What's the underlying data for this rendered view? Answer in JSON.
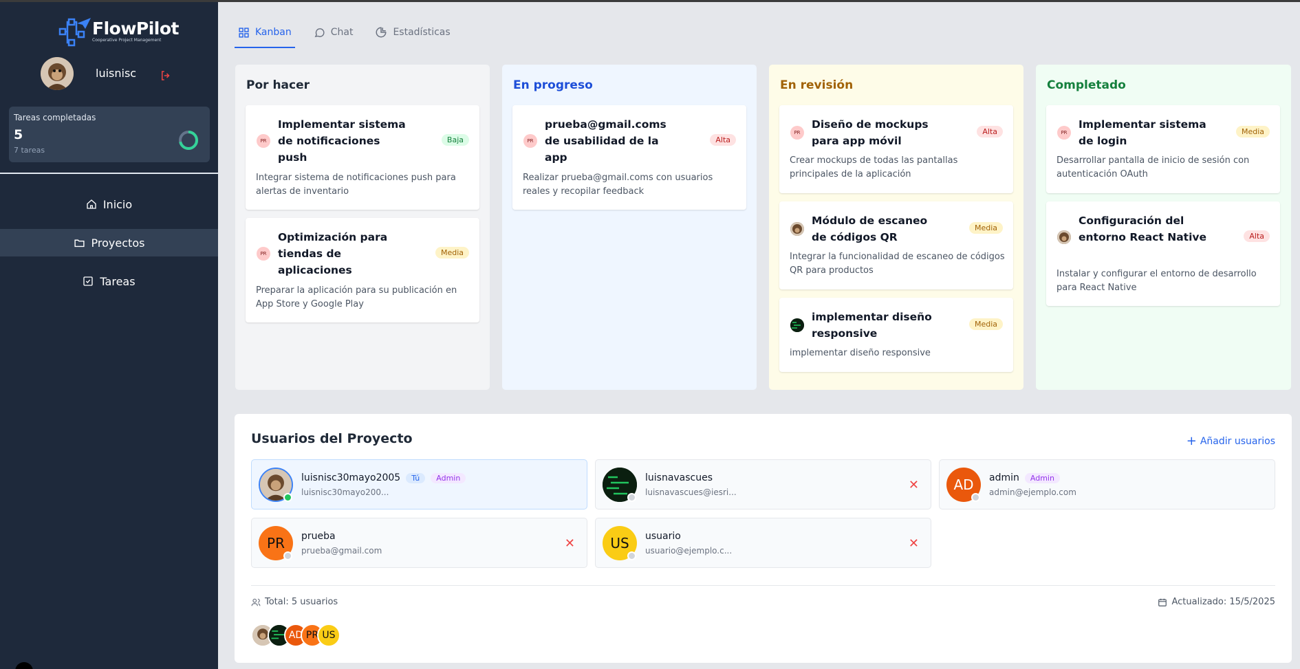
{
  "app": {
    "name": "FlowPilot",
    "tagline": "Cooperative Project Management"
  },
  "sidebar": {
    "user_name": "luisnisc",
    "stats": {
      "label": "Tareas completadas",
      "count": "5",
      "total": "7 tareas",
      "progress": 0.714
    },
    "nav": [
      {
        "label": "Inicio",
        "icon": "home-icon"
      },
      {
        "label": "Proyectos",
        "icon": "folder-icon",
        "active": true
      },
      {
        "label": "Tareas",
        "icon": "check-square-icon"
      }
    ]
  },
  "tabs": [
    {
      "label": "Kanban",
      "icon": "grid-icon",
      "active": true
    },
    {
      "label": "Chat",
      "icon": "chat-bubble-icon"
    },
    {
      "label": "Estadísticas",
      "icon": "pie-chart-icon"
    }
  ],
  "columns": [
    {
      "title": "Por hacer",
      "color": "#1f2937",
      "bg": "#f3f4f6",
      "cards": [
        {
          "avatar": "PR",
          "title": "Implementar sistema de notificaciones push",
          "priority": "Baja",
          "desc": "Integrar sistema de notificaciones push para alertas de inventario"
        },
        {
          "avatar": "PR",
          "title": "Optimización para tiendas de aplicaciones",
          "priority": "Media",
          "desc": "Preparar la aplicación para su publicación en App Store y Google Play"
        }
      ]
    },
    {
      "title": "En progreso",
      "color": "#1d4ed8",
      "bg": "#eff6ff",
      "cards": [
        {
          "avatar": "PR",
          "title": "prueba@gmail.coms de usabilidad de la app",
          "priority": "Alta",
          "desc": "Realizar prueba@gmail.coms con usuarios reales y recopilar feedback"
        }
      ]
    },
    {
      "title": "En revisión",
      "color": "#a16207",
      "bg": "#fefce8",
      "cards": [
        {
          "avatar": "PR",
          "title": "Diseño de mockups para app móvil",
          "priority": "Alta",
          "desc": "Crear mockups de todas las pantallas principales de la aplicación"
        },
        {
          "avatar": "",
          "title": "Módulo de escaneo de códigos QR",
          "priority": "Media",
          "desc": "Integrar la funcionalidad de escaneo de códigos QR para productos"
        },
        {
          "avatar": "",
          "title": "implementar diseño responsive",
          "priority": "Media",
          "desc": "implementar diseño responsive"
        }
      ]
    },
    {
      "title": "Completado",
      "color": "#15803d",
      "bg": "#f0fdf4",
      "cards": [
        {
          "avatar": "PR",
          "title": "Implementar sistema de login",
          "priority": "Media",
          "desc": "Desarrollar pantalla de inicio de sesión con autenticación OAuth"
        },
        {
          "avatar": "",
          "title": "Configuración del entorno React Native",
          "priority": "Alta",
          "desc": "Instalar y configurar el entorno de desarrollo para React Native"
        }
      ]
    }
  ],
  "users_panel": {
    "title": "Usuarios del Proyecto",
    "add_label": "Añadir usuarios",
    "users": [
      {
        "name": "luisnisc30mayo2005",
        "email": "luisnisc30mayo200...",
        "you": "Tú",
        "admin": "Admin",
        "initials": "",
        "online": true
      },
      {
        "name": "luisnavascues",
        "email": "luisnavascues@iesri...",
        "you": "",
        "admin": "",
        "initials": "",
        "online": false,
        "removable": true
      },
      {
        "name": "admin",
        "email": "admin@ejemplo.com",
        "you": "",
        "admin": "Admin",
        "initials": "AD",
        "color": "#ea580c",
        "online": false
      },
      {
        "name": "prueba",
        "email": "prueba@gmail.com",
        "you": "",
        "admin": "",
        "initials": "PR",
        "color": "#f97316",
        "online": false,
        "removable": true
      },
      {
        "name": "usuario",
        "email": "usuario@ejemplo.c...",
        "you": "",
        "admin": "",
        "initials": "US",
        "color": "#facc15",
        "online": false,
        "removable": true
      }
    ],
    "total_label": "Total: 5 usuarios",
    "updated_label": "Actualizado: 15/5/2025",
    "stack": [
      "",
      "",
      "AD",
      "PR",
      "US"
    ]
  }
}
